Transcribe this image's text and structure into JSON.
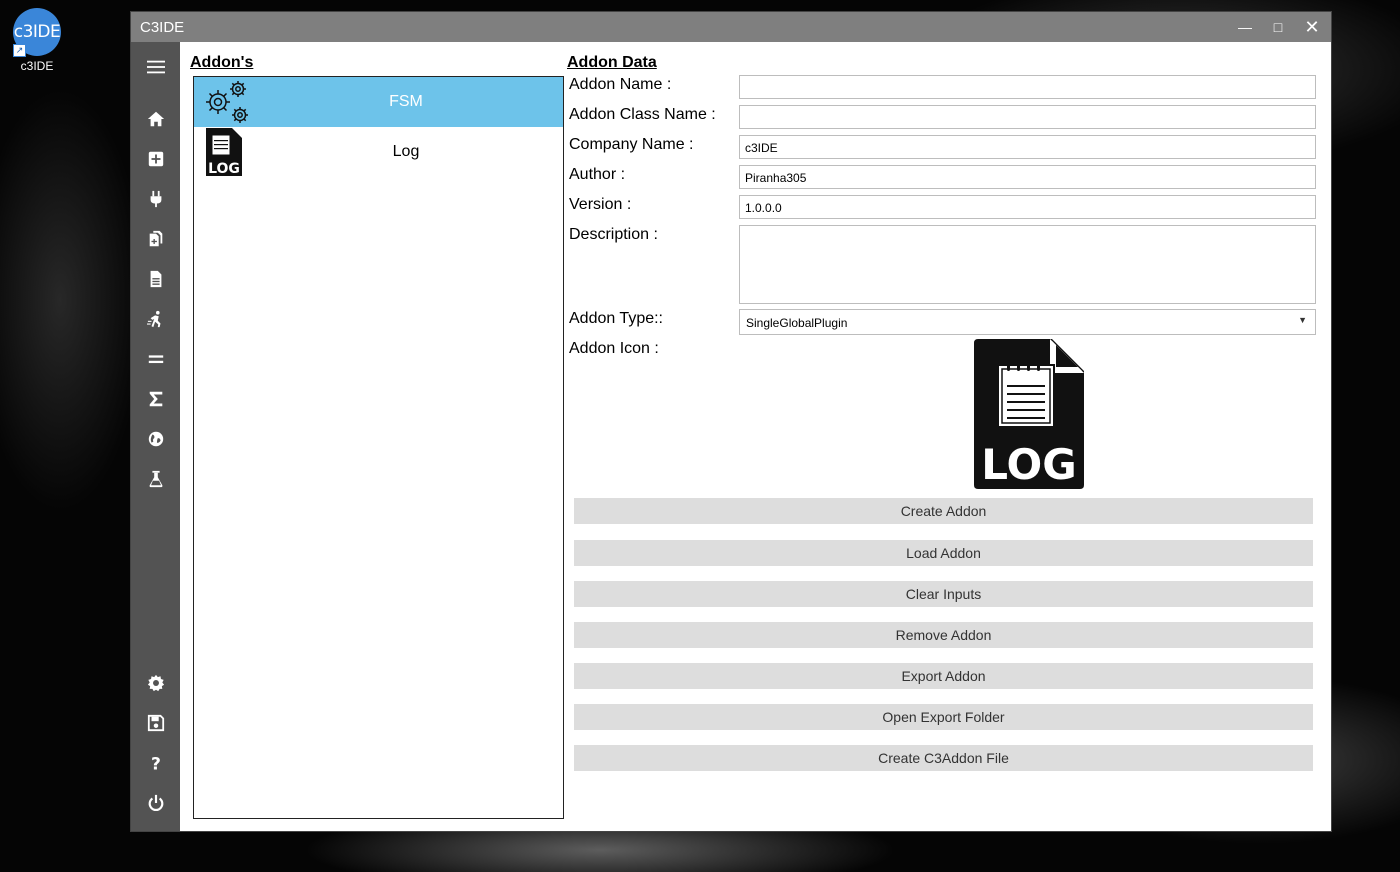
{
  "desktop": {
    "shortcut_icon_text": "c3IDE",
    "shortcut_label": "c3IDE"
  },
  "window": {
    "title": "C3IDE",
    "controls": {
      "minimize": "minimize",
      "maximize": "maximize",
      "close": "close"
    }
  },
  "sidebar": {
    "top_items": [
      "menu-icon",
      "home-icon",
      "add-icon",
      "plug-icon",
      "copy-file-icon",
      "file-icon",
      "run-icon",
      "equals-icon",
      "sigma-icon",
      "globe-icon",
      "flask-icon"
    ],
    "bottom_items": [
      "gear-icon",
      "save-icon",
      "help-icon",
      "power-icon"
    ]
  },
  "addons": {
    "heading": "Addon's",
    "items": [
      {
        "name": "FSM",
        "icon": "gears-icon",
        "selected": true
      },
      {
        "name": "Log",
        "icon": "log-file-icon",
        "selected": false
      }
    ]
  },
  "addon_data": {
    "heading": "Addon Data",
    "labels": {
      "addon_name": "Addon Name :",
      "addon_class_name": "Addon Class Name :",
      "company_name": "Company Name :",
      "author": "Author :",
      "version": "Version :",
      "description": "Description :",
      "addon_type": "Addon Type::",
      "addon_icon": "Addon Icon :"
    },
    "values": {
      "addon_name": "",
      "addon_class_name": "",
      "company_name": "c3IDE",
      "author": "Piranha305",
      "version": "1.0.0.0",
      "description": "",
      "addon_type": "SingleGlobalPlugin"
    },
    "icon_text": "LOG"
  },
  "actions": {
    "create": "Create Addon",
    "load": "Load Addon",
    "clear": "Clear Inputs",
    "remove": "Remove Addon",
    "export": "Export Addon",
    "open_folder": "Open Export Folder",
    "create_c3addon": "Create C3Addon File"
  },
  "colors": {
    "titlebar": "#7f7f7f",
    "sidebar": "#535353",
    "selected_row": "#6dc3ea",
    "button": "#dddddd"
  }
}
